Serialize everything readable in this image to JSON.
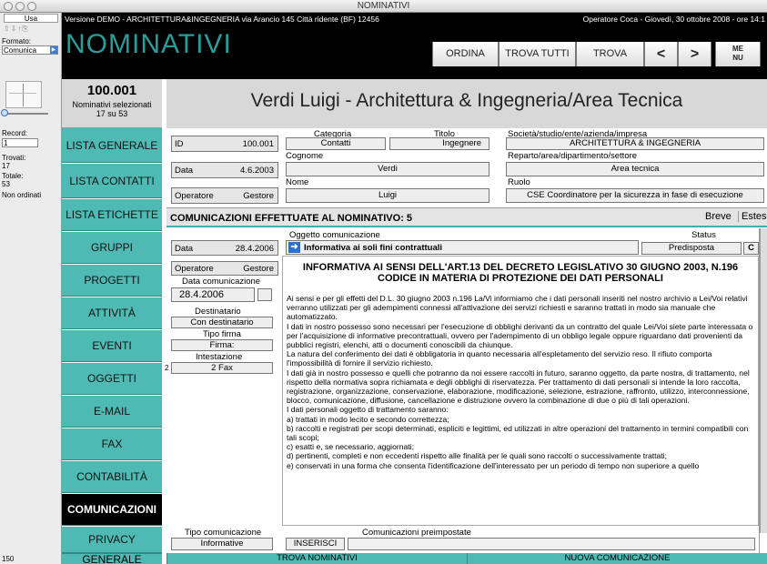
{
  "window": {
    "title": "NOMINATIVI"
  },
  "leftstrip": {
    "mode": "Usa",
    "formato_label": "Formato:",
    "formato_value": "Comunica",
    "record_label": "Record:",
    "record_value": "1",
    "trovati_label": "Trovati:",
    "trovati_value": "17",
    "totale_label": "Totale:",
    "totale_value": "53",
    "ordinati": "Non ordinati",
    "zoom": "150",
    "bottom_mode": "Usa"
  },
  "header": {
    "demo_text": "Versione DEMO - ARCHITETTURA&INGEGNERIA via Arancio 145 Città ridente (BF) 12456",
    "operator_text": "Operatore Coca - Giovedì, 30 ottobre 2008 - ore 14:1",
    "title": "NOMINATIVI",
    "btn_ordina": "ORDINA",
    "btn_trova_tutti": "TROVA TUTTI",
    "btn_trova": "TROVA",
    "btn_prev": "<",
    "btn_next": ">",
    "btn_menu": "ME NU"
  },
  "record": {
    "number": "100.001",
    "selected_label": "Nominativi selezionati",
    "selected_count": "17 su 53",
    "title": "Verdi Luigi - Architettura & Ingegneria/Area Tecnica"
  },
  "nav": [
    "LISTA GENERALE",
    "LISTA CONTATTI",
    "LISTA ETICHETTE",
    "GRUPPI",
    "PROGETTI",
    "ATTIVITÀ",
    "EVENTI",
    "OGGETTI",
    "E-MAIL",
    "FAX",
    "CONTABILITÀ",
    "COMUNICAZIONI",
    "PRIVACY",
    "GENERALE"
  ],
  "info": {
    "id_label": "ID",
    "id_value": "100.001",
    "data_label": "Data",
    "data_value": "4.6.2003",
    "operatore_label": "Operatore",
    "operatore_value": "Gestore",
    "categoria_label": "Categoria",
    "categoria_value": "Contatti",
    "titolo_label": "Titolo",
    "titolo_value": "Ingegnere",
    "cognome_label": "Cognome",
    "cognome_value": "Verdi",
    "nome_label": "Nome",
    "nome_value": "Luigi",
    "societa_label": "Società/studio/ente/azienda/impresa",
    "societa_value": "ARCHITETTURA & INGEGNERIA",
    "reparto_label": "Reparto/area/dipartimento/settore",
    "reparto_value": "Area tecnica",
    "ruolo_label": "Ruolo",
    "ruolo_value": "CSE Coordinatore per la sicurezza in fase di esecuzione"
  },
  "comm": {
    "header": "COMUNICAZIONI EFFETTUATE AL NOMINATIVO: 5",
    "btn_breve": "Breve",
    "btn_estesa": "Estesa",
    "data_label": "Data",
    "data_value": "28.4.2006",
    "operatore_label": "Operatore",
    "operatore_value": "Gestore",
    "data_com_label": "Data comunicazione",
    "data_com_value": "28.4.2006",
    "destinatario_label": "Destinatario",
    "destinatario_value": "Con destinatario",
    "tipo_firma_label": "Tipo firma",
    "tipo_firma_value": "Firma:",
    "intestazione_label": "Intestazione",
    "intestazione_value": "2 Fax",
    "oggetto_label": "Oggetto comunicazione",
    "oggetto_value": "Informativa ai soli fini contrattuali",
    "status_label": "Status",
    "status_value": "Predisposta",
    "c_btn": "C",
    "doc_title": "INFORMATIVA AI SENSI DELL'ART.13 DEL DECRETO LEGISLATIVO 30 GIUGNO 2003, N.196 CODICE IN MATERIA DI PROTEZIONE DEI DATI PERSONALI",
    "body": [
      "Ai sensi e per gli effetti del D.L. 30 giugno 2003 n.196 La/Vi informiamo che i dati personali inseriti nel nostro archivio a Lei/Voi relativi verranno utilizzati per gli adempimenti connessi all'attivazione dei servizi richiesti e saranno trattati in modo sia manuale che automatizzato.",
      "I dati in nostro possesso sono necessari per l'esecuzione di obblighi derivanti da un contratto del quale Lei/Voi siete parte interessata o per l'acquisizione di informative precontrattuali, ovvero per l'adempimento di un obbligo legale oppure riguardano dati provenienti da pubblici registri, elenchi, atti o documenti conoscibili da chiunque.",
      "La natura del conferimento dei dati è obbligatoria in quanto necessaria all'espletamento del servizio reso. Il rifiuto comporta l'impossibilità di fornire il servizio richiesto.",
      "I dati già in nostro possesso e quelli che potranno da noi essere raccolti in futuro, saranno oggetto, da parte nostra, di trattamento, nel rispetto della normativa sopra richiamata e degli obblighi di riservatezza. Per trattamento di dati personali si intende la loro raccolta, registrazione, organizzazione, conservazione, elaborazione, modificazione, selezione, estrazione, raffronto, utilizzo, interconnessione, blocco, comunicazione, diffusione, cancellazione e distruzione ovvero la combinazione di due o più di tali operazioni.",
      "I dati personali oggetto di trattamento saranno:",
      "a) trattati in modo lecito e secondo correttezza;",
      "b) raccolti e registrati per scopi determinati, espliciti e legittimi, ed utilizzati in altre operazioni del trattamento in termini compatibili con tali scopi;",
      "c) esatti e, se necessario, aggiornati;",
      "d) pertinenti, completi e non eccedenti rispetto alle finalità per le quali sono raccolti o successivamente trattati;",
      "e) conservati in una forma che consenta l'identificazione dell'interessato per un periodo di tempo non superiore a quello"
    ],
    "tipo_label": "Tipo comunicazione",
    "tipo_value": "Informative",
    "preimp_label": "Comunicazioni preimpostate",
    "btn_inserisci": "INSERISCI",
    "side_num": "2"
  },
  "footer": {
    "btn_trova": "TROVA NOMINATIVI CON COMUNICAZIONI",
    "btn_nuova": "NUOVA COMUNICAZIONE AL NOMINATIVO"
  }
}
